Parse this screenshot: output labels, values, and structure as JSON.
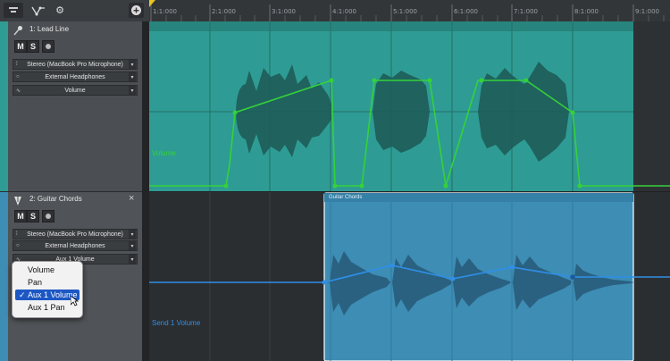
{
  "toolbar": {
    "icons": [
      "editor-mixer-toggle-icon",
      "automation-curve-icon",
      "gear-icon",
      "add-track-icon"
    ]
  },
  "ruler": {
    "ticks": [
      "1:1:000",
      "2:1:000",
      "3:1:000",
      "4:1:000",
      "5:1:000",
      "6:1:000",
      "7:1:000",
      "8:1:000",
      "9:1:000"
    ]
  },
  "tracks": [
    {
      "name": "1: Lead Line",
      "mute_label": "M",
      "solo_label": "S",
      "input": "Stereo (MacBook Pro Microphone)",
      "output": "External Headphones",
      "automation_param": "Volume",
      "lane_label": "Volume",
      "color": "#2e9c94"
    },
    {
      "name": "2: Guitar Chords",
      "close_glyph": "×",
      "mute_label": "M",
      "solo_label": "S",
      "input": "Stereo (MacBook Pro Microphone)",
      "output": "External Headphones",
      "automation_param": "Aux 1 Volume",
      "lane_label": "Send 1 Volume",
      "region_name": "Guitar Chords",
      "color": "#3d8db5"
    }
  ],
  "popup_menu": {
    "items": [
      "Volume",
      "Pan",
      "Aux 1 Volume",
      "Aux 1 Pan"
    ],
    "selected": "Aux 1 Volume",
    "check_glyph": "✓"
  },
  "colors": {
    "automation_green": "#35d13a",
    "automation_blue": "#2f8fe8",
    "accent_selected": "#1d57c4"
  }
}
